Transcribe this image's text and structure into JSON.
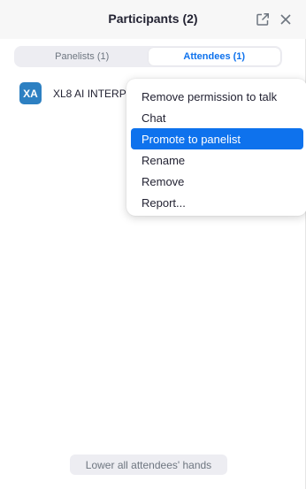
{
  "header": {
    "title": "Participants (2)",
    "popout_icon": "popout-icon",
    "close_icon": "close-icon"
  },
  "tabs": [
    {
      "label": "Panelists (1)",
      "active": false
    },
    {
      "label": "Attendees (1)",
      "active": true
    }
  ],
  "participants": [
    {
      "initials": "XA",
      "name": "XL8 AI INTERP",
      "avatar_color": "#2d80c2"
    }
  ],
  "context_menu": {
    "items": [
      {
        "label": "Remove permission to talk",
        "highlighted": false
      },
      {
        "label": "Chat",
        "highlighted": false
      },
      {
        "label": "Promote to panelist",
        "highlighted": true
      },
      {
        "label": "Rename",
        "highlighted": false
      },
      {
        "label": "Remove",
        "highlighted": false
      },
      {
        "label": "Report...",
        "highlighted": false
      }
    ]
  },
  "footer": {
    "lower_hands_label": "Lower all attendees' hands"
  },
  "colors": {
    "accent": "#0e72ed",
    "header_bg": "#f7f7f7",
    "segment_bg": "#ededf2"
  }
}
